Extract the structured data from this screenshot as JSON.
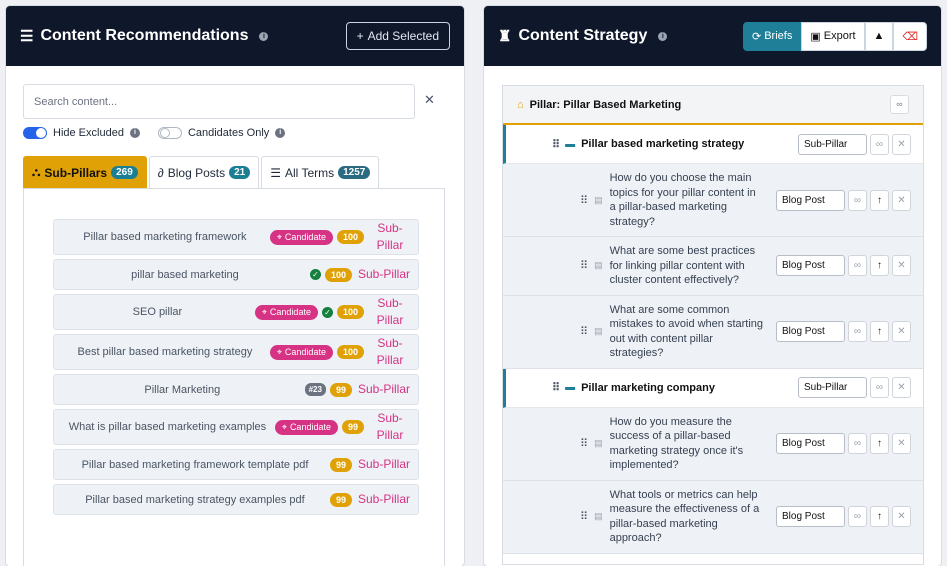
{
  "left": {
    "title": "Content Recommendations",
    "add_selected": "Add Selected",
    "search_placeholder": "Search content...",
    "toggle_hide_excluded": "Hide Excluded",
    "toggle_candidates_only": "Candidates Only",
    "tabs": [
      {
        "label": "Sub-Pillars",
        "count": "269"
      },
      {
        "label": "Blog Posts",
        "count": "21"
      },
      {
        "label": "All Terms",
        "count": "1257"
      }
    ],
    "candidate_label": "Candidate",
    "items": [
      {
        "name": "Pillar based marketing framework",
        "candidate": true,
        "check": false,
        "rank": "",
        "score": "100",
        "type": "Sub-Pillar"
      },
      {
        "name": "pillar based marketing",
        "candidate": false,
        "check": true,
        "rank": "",
        "score": "100",
        "type": "Sub-Pillar"
      },
      {
        "name": "SEO pillar",
        "candidate": true,
        "check": true,
        "rank": "",
        "score": "100",
        "type": "Sub-Pillar"
      },
      {
        "name": "Best pillar based marketing strategy",
        "candidate": true,
        "check": false,
        "rank": "",
        "score": "100",
        "type": "Sub-Pillar"
      },
      {
        "name": "Pillar Marketing",
        "candidate": false,
        "check": false,
        "rank": "#23",
        "score": "99",
        "type": "Sub-Pillar"
      },
      {
        "name": "What is pillar based marketing examples",
        "candidate": true,
        "check": false,
        "rank": "",
        "score": "99",
        "type": "Sub-Pillar"
      },
      {
        "name": "Pillar based marketing framework template pdf",
        "candidate": false,
        "check": false,
        "rank": "",
        "score": "99",
        "type": "Sub-Pillar"
      },
      {
        "name": "Pillar based marketing strategy examples pdf",
        "candidate": false,
        "check": false,
        "rank": "",
        "score": "99",
        "type": "Sub-Pillar"
      }
    ]
  },
  "right": {
    "title": "Content Strategy",
    "briefs": "Briefs",
    "export": "Export",
    "pillar_label": "Pillar: Pillar Based Marketing",
    "rows": [
      {
        "kind": "sub",
        "text": "Pillar based marketing strategy",
        "type": "Sub-Pillar"
      },
      {
        "kind": "blog",
        "text": "How do you choose the main topics for your pillar content in a pillar-based marketing strategy?",
        "type": "Blog Post"
      },
      {
        "kind": "blog",
        "text": "What are some best practices for linking pillar content with cluster content effectively?",
        "type": "Blog Post"
      },
      {
        "kind": "blog",
        "text": "What are some common mistakes to avoid when starting out with content pillar strategies?",
        "type": "Blog Post"
      },
      {
        "kind": "sub",
        "text": "Pillar marketing company",
        "type": "Sub-Pillar"
      },
      {
        "kind": "blog",
        "text": "How do you measure the success of a pillar-based marketing strategy once it's implemented?",
        "type": "Blog Post"
      },
      {
        "kind": "blog",
        "text": "What tools or metrics can help measure the effectiveness of a pillar-based marketing approach?",
        "type": "Blog Post"
      }
    ]
  },
  "colors": {
    "accent": "#e0a106",
    "teal": "#1f7f99",
    "candidate": "#d63384",
    "header": "#0f172a"
  },
  "icons": [
    "list-icon",
    "info-icon",
    "plus-icon",
    "sitemap-icon",
    "blog-icon",
    "sync-icon",
    "file-export-icon",
    "drive-icon",
    "eraser-icon",
    "home-icon",
    "folder-icon",
    "doc-icon",
    "grip-icon",
    "link-icon",
    "arrow-up-icon",
    "close-icon",
    "check-icon",
    "crosshair-icon"
  ]
}
